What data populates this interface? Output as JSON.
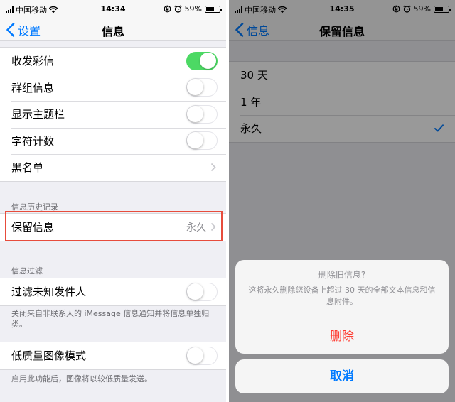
{
  "status_left": {
    "carrier": "中国移动",
    "time": "14:34",
    "battery": "59%",
    "battery_level": 0.59
  },
  "status_right": {
    "carrier": "中国移动",
    "time": "14:35",
    "battery": "59%",
    "battery_level": 0.59
  },
  "left_screen": {
    "nav": {
      "back_label": "设置",
      "title": "信息"
    },
    "group_top": [
      {
        "label": "收发彩信",
        "type": "switch",
        "on": true
      },
      {
        "label": "群组信息",
        "type": "switch",
        "on": false
      },
      {
        "label": "显示主题栏",
        "type": "switch",
        "on": false
      },
      {
        "label": "字符计数",
        "type": "switch",
        "on": false
      },
      {
        "label": "黑名单",
        "type": "disclosure"
      }
    ],
    "history_section": {
      "header": "信息历史记录",
      "keep_label": "保留信息",
      "keep_value": "永久"
    },
    "filter_section": {
      "header": "信息过滤",
      "filter_label": "过滤未知发件人",
      "filter_on": false,
      "filter_footer": "关闭来自非联系人的 iMessage 信息通知并将信息单独归类。"
    },
    "low_quality": {
      "label": "低质量图像模式",
      "on": false,
      "footer": "启用此功能后，图像将以较低质量发送。"
    },
    "highlight_color": "#e74c3c"
  },
  "right_screen": {
    "nav": {
      "back_label": "信息",
      "title": "保留信息"
    },
    "options": [
      {
        "label": "30 天",
        "checked": false
      },
      {
        "label": "1 年",
        "checked": false
      },
      {
        "label": "永久",
        "checked": true
      }
    ],
    "action_sheet": {
      "title": "删除旧信息?",
      "message": "这将永久删除您设备上超过 30 天的全部文本信息和信息附件。",
      "destructive_label": "删除",
      "cancel_label": "取消",
      "destructive_color": "#ff3b30",
      "cancel_color": "#007aff"
    }
  },
  "colors": {
    "ios_blue": "#007aff",
    "switch_green": "#4cd964",
    "background": "#efeff4"
  },
  "icons": [
    "signal-icon",
    "wifi-icon",
    "lock-rotation-icon",
    "alarm-icon",
    "battery-icon",
    "back-chevron-icon",
    "disclosure-chevron-icon",
    "checkmark-icon"
  ]
}
